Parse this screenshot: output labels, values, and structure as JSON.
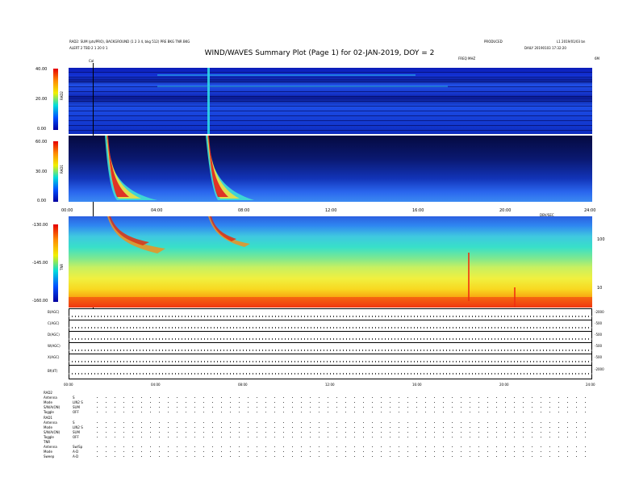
{
  "header": {
    "left_line1": "RAD2: SUM (pts/PRO), BACKGROUND (1 2 3 4, bkg 512)  PRE BKG  TNR BKG",
    "left_line2": "ALERT 2 TBD 2 1 20 0 1",
    "title": "WIND/WAVES Summary Plot (Page 1) for 02-JAN-2019, DOY = 2",
    "center_right": "PRODUCED",
    "right_top": "L1 2019/01/03 bn",
    "right_line2": "DAILY 20190103 17:32:20",
    "freq_label": "FREQ MHZ",
    "corner_label": "6M"
  },
  "panels": {
    "rad2": {
      "label": "RAD2",
      "ticks": [
        "40.00",
        "20.00",
        "0.00"
      ]
    },
    "rad1": {
      "label": "RAD1",
      "ticks": [
        "60.00",
        "30.00",
        "0.00"
      ]
    },
    "tnr": {
      "label": "TNR",
      "ticks": [
        "-130.00",
        "-145.00",
        "-160.00"
      ],
      "right_ticks": [
        "100",
        "10"
      ]
    },
    "marker_label": "Cal",
    "time_ticks": [
      "00:00",
      "04:00",
      "08:00",
      "12:00",
      "16:00",
      "20:00",
      "24:00"
    ],
    "time_right_label": "DBV/SEC"
  },
  "housekeeping": {
    "rows": [
      {
        "label": "B(AGC)",
        "right": "-2000"
      },
      {
        "label": "C(AGC)",
        "right": "-500"
      },
      {
        "label": "D(AGC)",
        "right": "-500"
      },
      {
        "label": "W(AGC)",
        "right": "-500"
      },
      {
        "label": "X(AGC)",
        "right": "-500"
      },
      {
        "label": "Bf(dT)",
        "right": "-2000"
      }
    ],
    "time_ticks": [
      "00:00",
      "04:00",
      "08:00",
      "12:00",
      "16:00",
      "20:00",
      "24:00"
    ]
  },
  "status_table": {
    "rad2": {
      "header": "RAD2",
      "rows": [
        {
          "key": "Antenna",
          "value": "S"
        },
        {
          "key": "Mode",
          "value": "LIN2 S"
        },
        {
          "key": "S/N/A(ON)",
          "value": "SUM"
        },
        {
          "key": "Toggle",
          "value": "OFF"
        }
      ]
    },
    "rad1": {
      "header": "RAD1",
      "rows": [
        {
          "key": "Antenna",
          "value": "S"
        },
        {
          "key": "Mode",
          "value": "LIN2 S"
        },
        {
          "key": "S/N/A(ON)",
          "value": "SUM"
        },
        {
          "key": "Toggle",
          "value": "OFF"
        }
      ]
    },
    "tnr": {
      "header": "TNR",
      "rows": [
        {
          "key": "Antenna",
          "value": "Sw/Sp"
        },
        {
          "key": "Mode",
          "value": "A-D"
        },
        {
          "key": "Sweep",
          "value": "A-D"
        }
      ]
    }
  },
  "chart_data": [
    {
      "type": "heatmap",
      "name_on_plot": "RAD2",
      "x": "time (hours)",
      "xlim": [
        0,
        24
      ],
      "ylim": [
        0,
        40
      ],
      "y_ticks": [
        40,
        20,
        0
      ],
      "bursts_hours": [
        1.9,
        6.4
      ]
    },
    {
      "type": "heatmap",
      "name_on_plot": "RAD1",
      "xlim": [
        0,
        24
      ],
      "ylim": [
        0,
        60
      ],
      "y_ticks": [
        60,
        30,
        0
      ],
      "bursts_hours": [
        1.9,
        6.4
      ],
      "x_ticks": [
        "00:00",
        "04:00",
        "08:00",
        "12:00",
        "16:00",
        "20:00",
        "24:00"
      ]
    },
    {
      "type": "heatmap",
      "name_on_plot": "TNR",
      "xlim": [
        0,
        24
      ],
      "ylim": [
        -160,
        -130
      ],
      "y_ticks": [
        -130,
        -145,
        -160
      ],
      "bursts_hours": [
        1.9,
        6.4
      ]
    }
  ],
  "colors": {
    "background": "#ffffff",
    "low": "#0000a0",
    "mid": "#00dcdc",
    "high": "#e60000"
  }
}
